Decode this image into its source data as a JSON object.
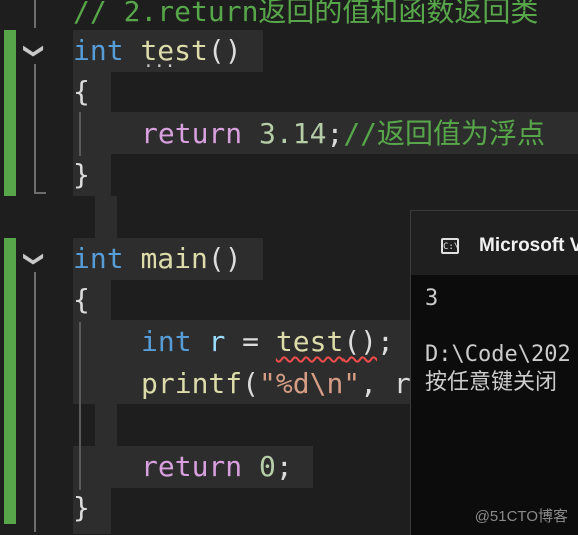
{
  "editor": {
    "lines": {
      "comment_top": "// 2.return返回的值和函数返回类",
      "test_sig_type": "int",
      "test_sig_name": "test",
      "test_sig_parens": "()",
      "brace_open_1": "{",
      "return_kw": "return",
      "return_val": "3.14",
      "return_semi": ";",
      "return_comment": "//返回值为浮点",
      "brace_close_1": "}",
      "main_sig_type": "int",
      "main_sig_name": "main",
      "main_sig_parens": "()",
      "brace_open_2": "{",
      "decl_type": "int",
      "decl_var": "r",
      "decl_eq": " = ",
      "decl_call": "test",
      "decl_parens": "()",
      "decl_semi": ";",
      "printf_name": "printf",
      "printf_open": "(",
      "printf_str": "\"%d\\n\"",
      "printf_rest": ", r",
      "return0_kw": "return",
      "return0_val": "0",
      "return0_semi": ";",
      "brace_close_2": "}"
    },
    "fold_glyph": "❯",
    "colors": {
      "keyword": "#569cd6",
      "function": "#dcdcaa",
      "number": "#b5cea8",
      "comment": "#57a64a",
      "string": "#d69d85",
      "control": "#d8a0df",
      "variable": "#9cdcfe",
      "change_bar": "#57a64a"
    }
  },
  "console": {
    "title": "Microsoft Vi",
    "icon_text": "C:\\",
    "output_line_1": "3",
    "output_line_2": "D:\\Code\\202",
    "output_line_3": "按任意键关闭"
  },
  "watermark": "@51CTO博客"
}
